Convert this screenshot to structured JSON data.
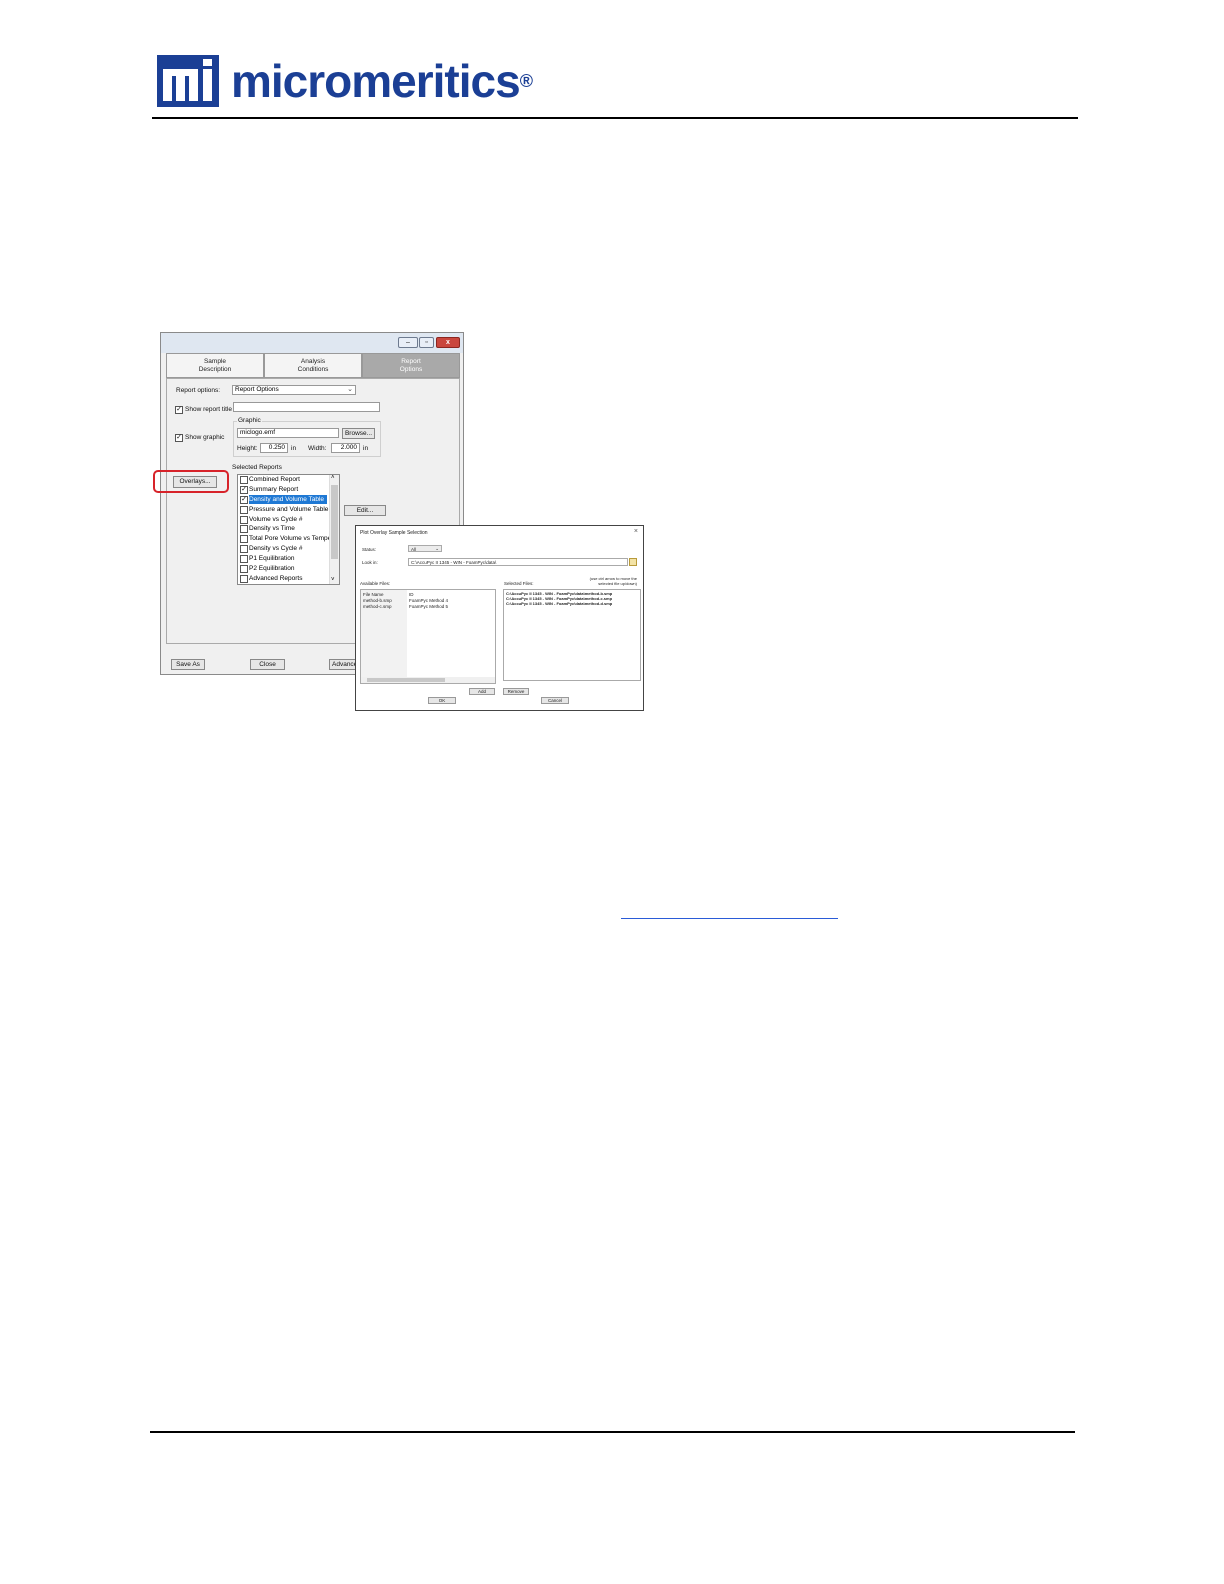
{
  "brand": {
    "wordmark": "micromeritics",
    "registered": "®",
    "color": "#1b3f95"
  },
  "main_dialog": {
    "window_buttons": [
      "–",
      "▫",
      "x"
    ],
    "tabs": [
      {
        "label_line1": "Sample",
        "label_line2": "Description",
        "active": false
      },
      {
        "label_line1": "Analysis",
        "label_line2": "Conditions",
        "active": false
      },
      {
        "label_line1": "Report",
        "label_line2": "Options",
        "active": true
      }
    ],
    "report_options_label": "Report options:",
    "report_options_value": "Report Options",
    "show_report_title_label": "Show report title",
    "show_report_title_checked": true,
    "show_graphic_label": "Show graphic",
    "show_graphic_checked": true,
    "graphic_group_label": "Graphic",
    "graphic_file": "miclogo.emf",
    "browse_label": "Browse...",
    "height_label": "Height:",
    "height_value": "0.250",
    "height_unit": "in",
    "width_label": "Width:",
    "width_value": "2.000",
    "width_unit": "in",
    "overlays_label": "Overlays...",
    "selected_reports_label": "Selected Reports",
    "edit_label": "Edit...",
    "reports": [
      {
        "label": "Combined Report",
        "checked": false,
        "selected": false
      },
      {
        "label": "Summary Report",
        "checked": true,
        "selected": false
      },
      {
        "label": "Density and Volume Table",
        "checked": true,
        "selected": true
      },
      {
        "label": "Pressure and Volume Table",
        "checked": false,
        "selected": false
      },
      {
        "label": "Volume vs Cycle #",
        "checked": false,
        "selected": false
      },
      {
        "label": "Density vs Time",
        "checked": false,
        "selected": false
      },
      {
        "label": "Total Pore Volume vs Tempe",
        "checked": false,
        "selected": false
      },
      {
        "label": "Density vs Cycle #",
        "checked": false,
        "selected": false
      },
      {
        "label": "P1 Equilibration",
        "checked": false,
        "selected": false
      },
      {
        "label": "P2 Equilibration",
        "checked": false,
        "selected": false
      },
      {
        "label": "Advanced Reports",
        "checked": false,
        "selected": false
      }
    ],
    "save_as_label": "Save As",
    "close_label": "Close",
    "advanced_label": "Advance"
  },
  "overlay_dialog": {
    "title": "Plot Overlay Sample Selection",
    "close_glyph": "×",
    "status_label": "Status:",
    "status_value": "All",
    "look_in_label": "Look in:",
    "look_in_value": "C:\\AccuPyc II 1345 - WIN - FoamPyc\\data\\",
    "available_files_label": "Available Files:",
    "selected_files_label": "Selected Files:",
    "hint": "(use ctrl arrow to move the selected file up/down)",
    "available_header": [
      "File Name",
      "ID"
    ],
    "available_rows": [
      [
        "method-b.smp",
        "FoamPyc Method 4"
      ],
      [
        "method-c.smp",
        "FoamPyc Method 5"
      ]
    ],
    "selected_rows": [
      "C:\\AccuPyc II 1345 - WIN - FoamPyc\\data\\method-b.smp",
      "C:\\AccuPyc II 1345 - WIN - FoamPyc\\data\\method-c.smp",
      "C:\\AccuPyc II 1345 - WIN - FoamPyc\\data\\method-d.smp"
    ],
    "add_label": "Add",
    "remove_label": "Remove",
    "ok_label": "OK",
    "cancel_label": "Cancel"
  }
}
